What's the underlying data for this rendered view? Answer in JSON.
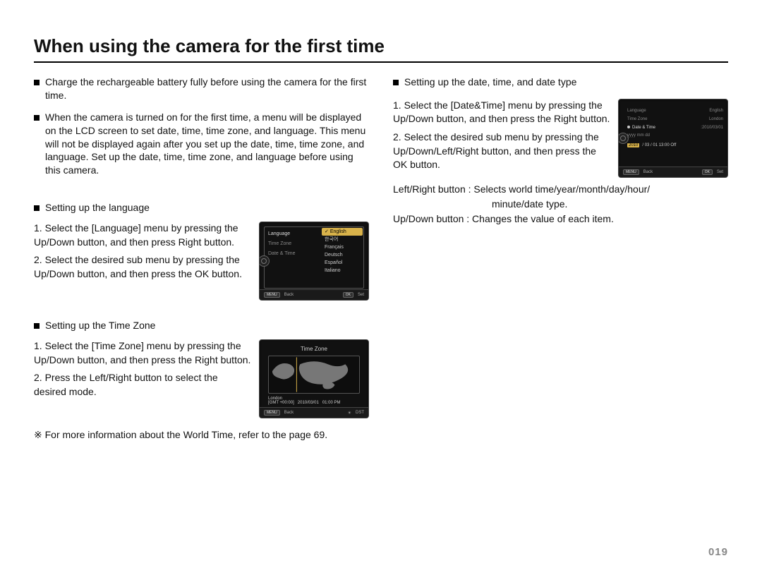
{
  "title": "When using the camera for the first time",
  "pageNumber": "019",
  "left": {
    "p1": "Charge the rechargeable battery fully before using the camera for the first time.",
    "p2": "When the camera is turned on for the first time, a menu will be displayed on the LCD screen to set date, time, time zone, and language. This menu will not be displayed again after you set up the date, time, time zone, and language. Set up the date, time, time zone, and language before using this camera.",
    "langHeading": "Setting up the language",
    "langStep1": "1. Select the [Language] menu by pressing the Up/Down button, and then press Right button.",
    "langStep2": "2. Select the desired sub menu by pressing the Up/Down button, and then press the OK button.",
    "tzHeading": "Setting up the Time Zone",
    "tzStep1": "1. Select the [Time Zone] menu by pressing the Up/Down button, and then press the Right button.",
    "tzStep2": "2. Press the Left/Right button to select the desired mode.",
    "tzNote": "※ For more information about the World Time, refer to the page 69."
  },
  "right": {
    "dtHeading": "Setting up the date, time, and date type",
    "dtStep1": "1. Select the [Date&Time] menu by pressing the Up/Down button, and then press the Right button.",
    "dtStep2": "2. Select the desired sub menu by pressing the Up/Down/Left/Right button, and then press the OK button.",
    "lr": "Left/Right button : Selects world time/year/month/day/hour/",
    "lr2": "minute/date type.",
    "ud": "Up/Down button  : Changes the value of each item."
  },
  "lcdLang": {
    "left": [
      "Language",
      "Time Zone",
      "Date & Time"
    ],
    "right": [
      "English",
      "한국어",
      "Français",
      "Deutsch",
      "Español",
      "Italiano"
    ],
    "footBack": "Back",
    "footSet": "Set",
    "badgeBack": "MENU",
    "badgeSet": "OK"
  },
  "lcdTz": {
    "title": "Time Zone",
    "city": "London",
    "gmt": "[GMT +00:00]",
    "date": "2010/03/01",
    "time": "01:00 PM",
    "footBack": "Back",
    "footDst": "DST",
    "badgeBack": "MENU"
  },
  "lcdDt": {
    "left": [
      "Language",
      "Time Zone",
      "Date & Time"
    ],
    "rvals": [
      "English",
      "London",
      ":2010/03/01"
    ],
    "fmt": "yyyy  mm  dd",
    "rowYear": "2010",
    "rowRest": "/ 03 / 01    13:00   Off",
    "footBack": "Back",
    "footSet": "Set",
    "badgeBack": "MENU",
    "badgeSet": "OK"
  }
}
